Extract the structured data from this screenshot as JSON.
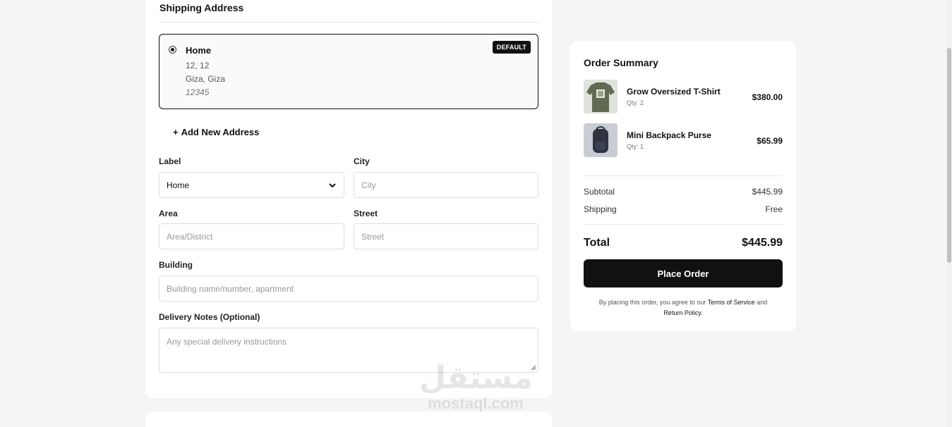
{
  "shipping": {
    "title": "Shipping Address",
    "saved_address": {
      "label": "Home",
      "line1": "12, 12",
      "line2": "Giza, Giza",
      "postal": "12345",
      "badge": "DEFAULT"
    },
    "add_new": {
      "plus": "+",
      "label": "Add New Address"
    },
    "form": {
      "label_field": {
        "label": "Label",
        "value": "Home"
      },
      "city_field": {
        "label": "City",
        "placeholder": "City"
      },
      "area_field": {
        "label": "Area",
        "placeholder": "Area/District"
      },
      "street_field": {
        "label": "Street",
        "placeholder": "Street"
      },
      "building_field": {
        "label": "Building",
        "placeholder": "Building name/number, apartment"
      },
      "notes_field": {
        "label": "Delivery Notes (Optional)",
        "placeholder": "Any special delivery instructions"
      }
    }
  },
  "summary": {
    "title": "Order Summary",
    "items": [
      {
        "name": "Grow Oversized T-Shirt",
        "qty": "Qty: 2",
        "price": "$380.00"
      },
      {
        "name": "Mini Backpack Purse",
        "qty": "Qty: 1",
        "price": "$65.99"
      }
    ],
    "subtotal": {
      "label": "Subtotal",
      "value": "$445.99"
    },
    "shipping": {
      "label": "Shipping",
      "value": "Free"
    },
    "total": {
      "label": "Total",
      "value": "$445.99"
    },
    "place_order": "Place Order",
    "terms": {
      "prefix": "By placing this order, you agree to our",
      "tos": "Terms of Service",
      "and": "and",
      "return": "Return Policy",
      "suffix": "."
    }
  },
  "watermark": {
    "arabic": "مستقل",
    "latin": "mostaql.com"
  },
  "colors": {
    "accent": "#111111",
    "background": "#f5f5f5",
    "card": "#ffffff",
    "border": "#dddddd"
  }
}
